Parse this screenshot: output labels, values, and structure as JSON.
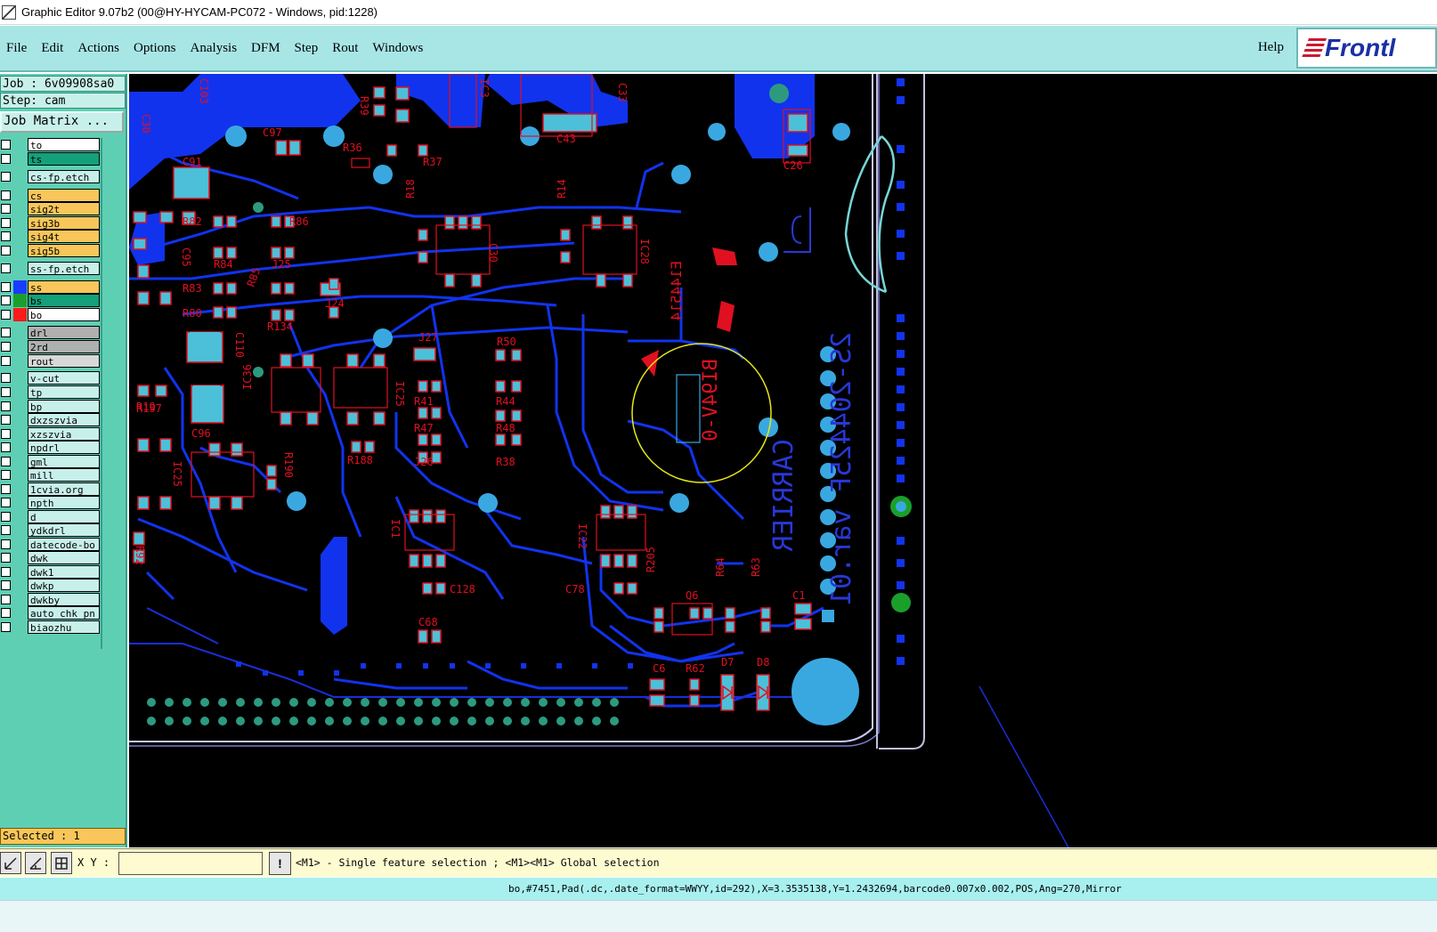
{
  "window": {
    "title": "Graphic Editor 9.07b2 (00@HY-HYCAM-PC072 - Windows, pid:1228)"
  },
  "menu": {
    "items": [
      "File",
      "Edit",
      "Actions",
      "Options",
      "Analysis",
      "DFM",
      "Step",
      "Rout",
      "Windows"
    ],
    "help": "Help",
    "logo": "Frontl"
  },
  "job": {
    "line": "Job : 6v09908sa0",
    "step": "Step: cam",
    "matrix_button": "Job Matrix ..."
  },
  "layers": [
    {
      "name": "to",
      "row_color": "#ffffff",
      "swatch": ""
    },
    {
      "name": "ts",
      "row_color": "#14a07a",
      "swatch": ""
    },
    {
      "name": "cs-fp.etch",
      "row_color": "#c8f0ea",
      "swatch": ""
    },
    {
      "name": "cs",
      "row_color": "#f8c65a",
      "swatch": ""
    },
    {
      "name": "sig2t",
      "row_color": "#f8c65a",
      "swatch": ""
    },
    {
      "name": "sig3b",
      "row_color": "#f8c65a",
      "swatch": ""
    },
    {
      "name": "sig4t",
      "row_color": "#f8c65a",
      "swatch": ""
    },
    {
      "name": "sig5b",
      "row_color": "#f8c65a",
      "swatch": ""
    },
    {
      "name": "ss-fp.etch",
      "row_color": "#c8f0ea",
      "swatch": ""
    },
    {
      "name": "ss",
      "row_color": "#f8c65a",
      "swatch": "#1a3cff"
    },
    {
      "name": "bs",
      "row_color": "#14a07a",
      "swatch": "#1aa02a"
    },
    {
      "name": "bo",
      "row_color": "#ffffff",
      "swatch": "#ff1a1a"
    },
    {
      "name": "drl",
      "row_color": "#b0b0b0",
      "swatch": ""
    },
    {
      "name": "2rd",
      "row_color": "#b0b0b0",
      "swatch": ""
    },
    {
      "name": "rout",
      "row_color": "#d8d8d8",
      "swatch": ""
    },
    {
      "name": "v-cut",
      "row_color": "#c8f0ea",
      "swatch": ""
    },
    {
      "name": "tp",
      "row_color": "#c8f0ea",
      "swatch": ""
    },
    {
      "name": "bp",
      "row_color": "#c8f0ea",
      "swatch": ""
    },
    {
      "name": "dxzszvia",
      "row_color": "#c8f0ea",
      "swatch": ""
    },
    {
      "name": "xzszvia",
      "row_color": "#c8f0ea",
      "swatch": ""
    },
    {
      "name": "npdrl",
      "row_color": "#c8f0ea",
      "swatch": ""
    },
    {
      "name": "gml",
      "row_color": "#c8f0ea",
      "swatch": ""
    },
    {
      "name": "mill",
      "row_color": "#c8f0ea",
      "swatch": ""
    },
    {
      "name": "1cvia.org",
      "row_color": "#c8f0ea",
      "swatch": ""
    },
    {
      "name": "npth",
      "row_color": "#c8f0ea",
      "swatch": ""
    },
    {
      "name": "d",
      "row_color": "#c8f0ea",
      "swatch": ""
    },
    {
      "name": "ydkdrl",
      "row_color": "#c8f0ea",
      "swatch": ""
    },
    {
      "name": "datecode-bo",
      "row_color": "#c8f0ea",
      "swatch": ""
    },
    {
      "name": "dwk",
      "row_color": "#c8f0ea",
      "swatch": ""
    },
    {
      "name": "dwk1",
      "row_color": "#c8f0ea",
      "swatch": ""
    },
    {
      "name": "dwkp",
      "row_color": "#c8f0ea",
      "swatch": ""
    },
    {
      "name": "dwkby",
      "row_color": "#c8f0ea",
      "swatch": ""
    },
    {
      "name": "auto_chk_pn",
      "row_color": "#c8f0ea",
      "swatch": ""
    },
    {
      "name": "biaozhu",
      "row_color": "#c8f0ea",
      "swatch": ""
    }
  ],
  "selected": "Selected : 1",
  "canvas": {
    "refdes": [
      "C30",
      "C103",
      "C97",
      "C91",
      "R39",
      "R36",
      "R37",
      "IC3",
      "C43",
      "C33",
      "C26",
      "R82",
      "R86",
      "R84",
      "J25",
      "R83",
      "R85",
      "R80",
      "J24",
      "R134",
      "C110",
      "R19",
      "C96",
      "C95",
      "IC36",
      "J27",
      "R50",
      "IC25",
      "R41",
      "R44",
      "R47",
      "R48",
      "J26",
      "R38",
      "R188",
      "R190",
      "C30",
      "IC30",
      "IC28",
      "R18",
      "R14",
      "C17",
      "IC1",
      "C128",
      "C78",
      "IC22",
      "C68",
      "R205",
      "Q6",
      "R64",
      "R63",
      "C1",
      "C6",
      "R62",
      "D7",
      "D8",
      "R197",
      "IC25",
      "R92",
      "R63"
    ],
    "silk_lines": [
      "2S-204425F var.01",
      "CARRIER",
      "BI94V-0",
      "E144514"
    ]
  },
  "cmdbar": {
    "xy_label": "X Y :",
    "xy_value": "",
    "warn": "!",
    "hint": "<M1> - Single feature selection ; <M1><M1> Global selection"
  },
  "status": "bo,#7451,Pad(.dc,.date_format=WWYY,id=292),X=3.3535138,Y=1.2432694,barcode0.007x0.002,POS,Ang=270,Mirror"
}
